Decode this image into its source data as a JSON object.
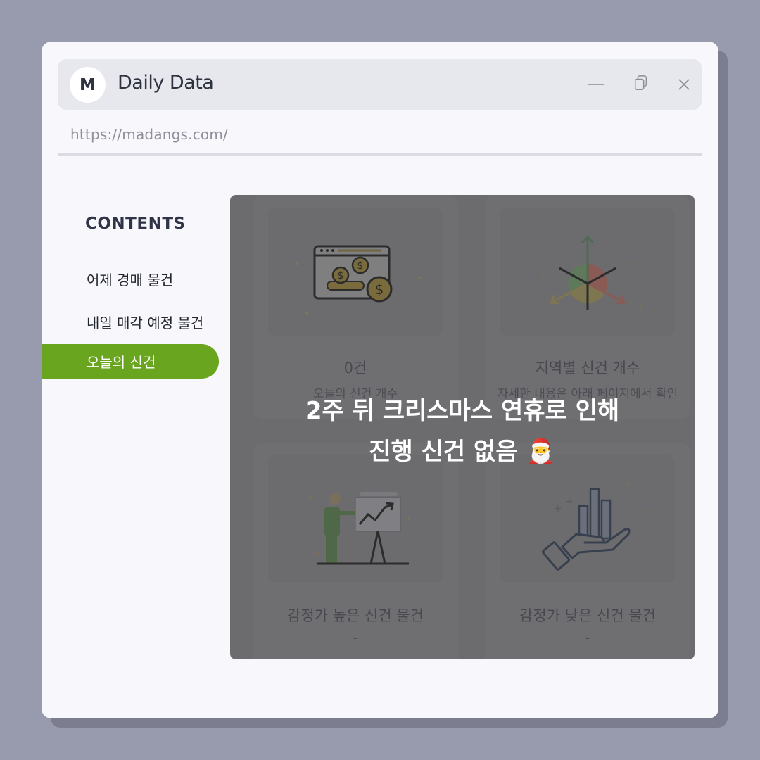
{
  "window": {
    "avatar_letter": "M",
    "title": "Daily Data",
    "url": "https://madangs.com/"
  },
  "sidebar": {
    "heading": "CONTENTS",
    "items": [
      {
        "label": "어제 경매 물건"
      },
      {
        "label": "내일 매각 예정 물건"
      },
      {
        "label": "오늘의 신건"
      }
    ],
    "active_color": "#6aa51f"
  },
  "cards": [
    {
      "title": "0건",
      "subtitle": "오늘의 신건 개수",
      "icon": "money-browser-icon"
    },
    {
      "title": "지역별 신건 개수",
      "subtitle": "자세한 내용은 아래 페이지에서 확인",
      "icon": "three-axis-chart-icon"
    },
    {
      "title": "감정가 높은 신건 물건",
      "subtitle": "-",
      "icon": "presentation-growth-icon"
    },
    {
      "title": "감정가 낮은 신건 물건",
      "subtitle": "-",
      "icon": "hand-bar-chart-icon"
    }
  ],
  "overlay": {
    "line1": "2주 뒤 크리스마스 연휴로 인해",
    "line2": "진행 신건 없음 🎅"
  }
}
